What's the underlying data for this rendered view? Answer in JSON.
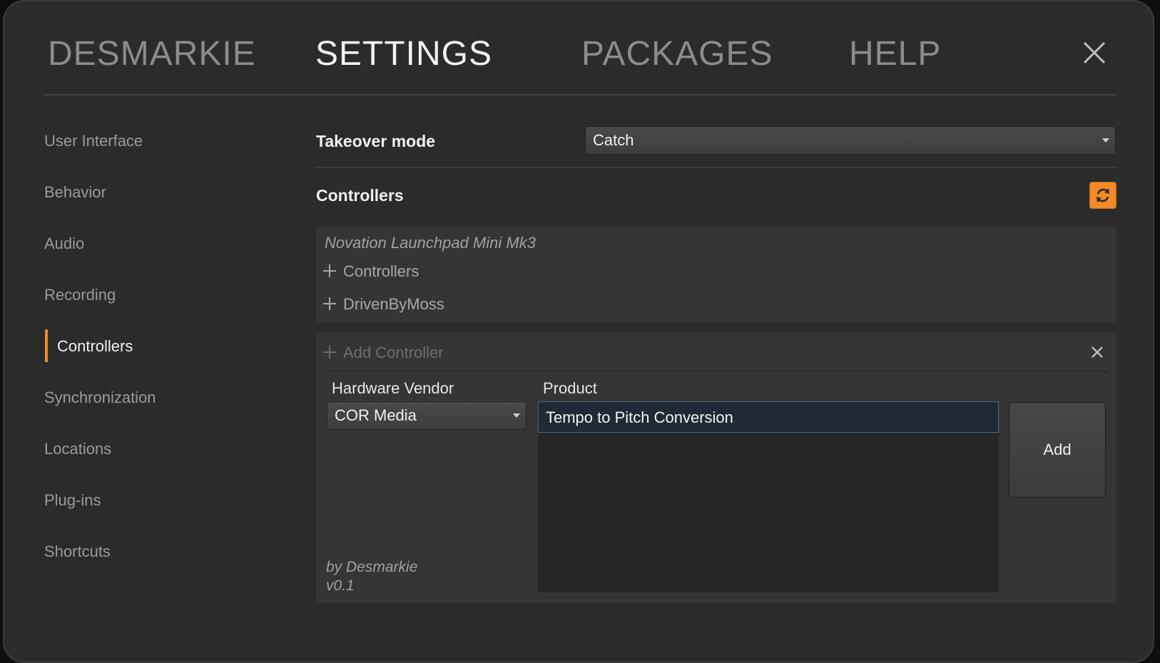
{
  "nav": {
    "tabs": [
      {
        "label": "DESMARKIE"
      },
      {
        "label": "SETTINGS"
      },
      {
        "label": "PACKAGES"
      },
      {
        "label": "HELP"
      }
    ],
    "active_tab": "SETTINGS"
  },
  "sidebar": {
    "items": [
      {
        "label": "User Interface"
      },
      {
        "label": "Behavior"
      },
      {
        "label": "Audio"
      },
      {
        "label": "Recording"
      },
      {
        "label": "Controllers"
      },
      {
        "label": "Synchronization"
      },
      {
        "label": "Locations"
      },
      {
        "label": "Plug-ins"
      },
      {
        "label": "Shortcuts"
      }
    ],
    "active_item": "Controllers",
    "accent_color": "#f28a28"
  },
  "settings": {
    "takeover_label": "Takeover mode",
    "takeover_value": "Catch",
    "controllers_label": "Controllers",
    "refresh_icon": "refresh-icon"
  },
  "controllers_panel": {
    "device_name": "Novation Launchpad Mini Mk3",
    "tree_items": [
      {
        "label": "Controllers"
      },
      {
        "label": "DrivenByMoss"
      }
    ]
  },
  "add_panel": {
    "title": "Add Controller",
    "vendor_label": "Hardware Vendor",
    "vendor_value": "COR Media",
    "product_label": "Product",
    "products": [
      "Tempo to Pitch Conversion"
    ],
    "add_button": "Add",
    "author": "by Desmarkie",
    "version": "v0.1"
  }
}
